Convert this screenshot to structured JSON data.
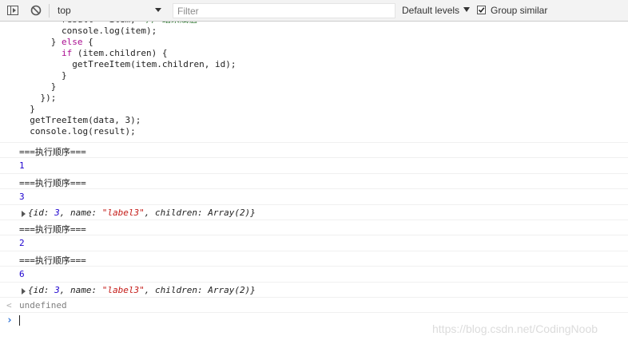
{
  "toolbar": {
    "context": "top",
    "filter_placeholder": "Filter",
    "filter_value": "",
    "levels_label": "Default levels",
    "group_label": "Group similar",
    "group_checked": true
  },
  "code_lines": [
    {
      "i": "        ",
      "parts": [
        [
          "t",
          "result = "
        ],
        [
          "t",
          "item"
        ],
        [
          "t",
          ";  "
        ],
        [
          "c",
          "// 结果赋值"
        ]
      ]
    },
    {
      "i": "        ",
      "parts": [
        [
          "t",
          "console.log(item);"
        ]
      ]
    },
    {
      "i": "      ",
      "parts": [
        [
          "t",
          "} "
        ],
        [
          "k",
          "else"
        ],
        [
          "t",
          " {"
        ]
      ]
    },
    {
      "i": "        ",
      "parts": [
        [
          "k",
          "if"
        ],
        [
          "t",
          " (item.children) {"
        ]
      ]
    },
    {
      "i": "          ",
      "parts": [
        [
          "t",
          "getTreeItem(item.children, id);"
        ]
      ]
    },
    {
      "i": "        ",
      "parts": [
        [
          "t",
          "}"
        ]
      ]
    },
    {
      "i": "      ",
      "parts": [
        [
          "t",
          "}"
        ]
      ]
    },
    {
      "i": "    ",
      "parts": [
        [
          "t",
          "});"
        ]
      ]
    },
    {
      "i": "  ",
      "parts": [
        [
          "t",
          "}"
        ]
      ]
    },
    {
      "i": "  ",
      "parts": [
        [
          "t",
          "getTreeItem(data, 3);"
        ]
      ]
    },
    {
      "i": "  ",
      "parts": [
        [
          "t",
          "console.log(result);"
        ]
      ]
    }
  ],
  "log": [
    {
      "type": "text",
      "text": "===执行顺序==="
    },
    {
      "type": "number",
      "text": "1"
    },
    {
      "type": "text",
      "text": "===执行顺序==="
    },
    {
      "type": "number",
      "text": "3"
    },
    {
      "type": "object",
      "id": "3",
      "name": "\"label3\"",
      "children": "Array(2)"
    },
    {
      "type": "text",
      "text": "===执行顺序==="
    },
    {
      "type": "number",
      "text": "2"
    },
    {
      "type": "text",
      "text": "===执行顺序==="
    },
    {
      "type": "number",
      "text": "6"
    },
    {
      "type": "object",
      "id": "3",
      "name": "\"label3\"",
      "children": "Array(2)"
    }
  ],
  "return_value": "undefined",
  "prompt_value": "",
  "watermark": "https://blog.csdn.net/CodingNoob",
  "icons": [
    "sidebar-toggle-icon",
    "clear-console-icon",
    "dropdown-arrow-icon",
    "checkbox-icon",
    "return-arrow-icon",
    "prompt-chevron-icon",
    "expand-triangle-icon"
  ]
}
